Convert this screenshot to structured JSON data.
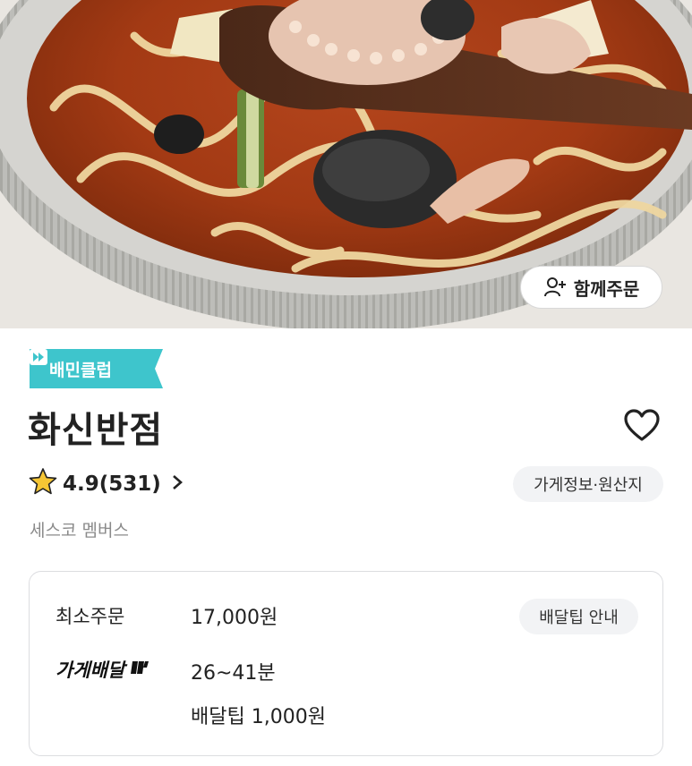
{
  "hero": {
    "image": "jjamppong-noodle-soup-photo",
    "group_order_label": "함께주문"
  },
  "badge": {
    "label": "배민클럽",
    "color": "#3ec5cc"
  },
  "store": {
    "name": "화신반점",
    "branch": "세스코 멤버스"
  },
  "rating": {
    "score": "4.9",
    "count": "(531)"
  },
  "buttons": {
    "store_info": "가게정보·원산지",
    "delivery_tip_info": "배달팁 안내"
  },
  "order_info": {
    "min_order_label": "최소주문",
    "min_order_value": "17,000원",
    "delivery_label": "가게배달",
    "delivery_time": "26~41분",
    "delivery_tip": "배달팁 1,000원"
  },
  "colors": {
    "star": "#f6c634",
    "heart": "#222222",
    "badge": "#3ec5cc"
  }
}
